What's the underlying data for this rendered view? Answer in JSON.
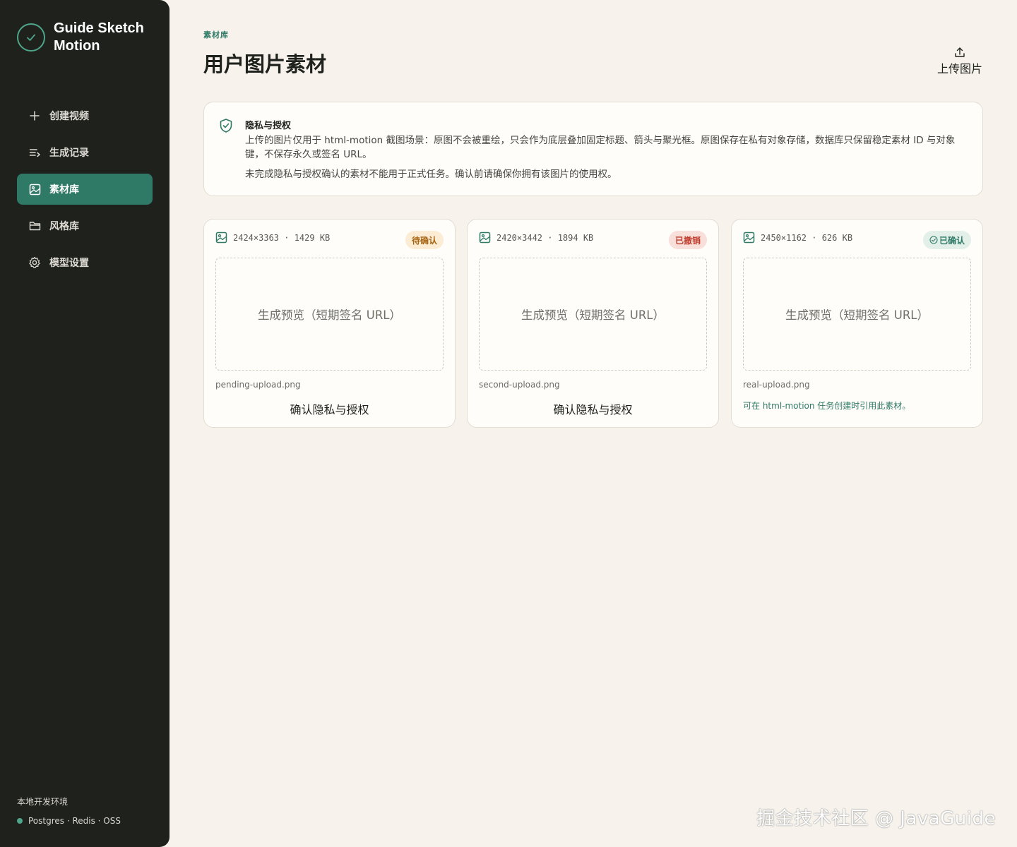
{
  "app": {
    "name": "Guide Sketch Motion"
  },
  "sidebar": {
    "items": [
      {
        "label": "创建视频",
        "icon": "plus-icon",
        "active": false
      },
      {
        "label": "生成记录",
        "icon": "list-icon",
        "active": false
      },
      {
        "label": "素材库",
        "icon": "image-icon",
        "active": true
      },
      {
        "label": "风格库",
        "icon": "folder-icon",
        "active": false
      },
      {
        "label": "模型设置",
        "icon": "gear-icon",
        "active": false
      }
    ],
    "env_label": "本地开发环境",
    "env_status": "Postgres · Redis · OSS"
  },
  "header": {
    "eyebrow": "素材库",
    "title": "用户图片素材",
    "upload_label": "上传图片"
  },
  "notice": {
    "title": "隐私与授权",
    "body": "上传的图片仅用于 html-motion 截图场景：原图不会被重绘，只会作为底层叠加固定标题、箭头与聚光框。原图保存在私有对象存储，数据库只保留稳定素材 ID 与对象键，不保存永久或签名 URL。",
    "body2": "未完成隐私与授权确认的素材不能用于正式任务。确认前请确保你拥有该图片的使用权。"
  },
  "cards": [
    {
      "meta": "2424×3363 · 1429 KB",
      "status": "待确认",
      "status_color": "#a86412",
      "preview_text": "生成预览（短期签名 URL）",
      "filename": "pending-upload.png",
      "action": "确认隐私与授权"
    },
    {
      "meta": "2420×3442 · 1894 KB",
      "status": "已撤销",
      "status_color": "#bf3a2a",
      "preview_text": "生成预览（短期签名 URL）",
      "filename": "second-upload.png",
      "action": "确认隐私与授权"
    },
    {
      "meta": "2450×1162 · 626 KB",
      "status": "已确认",
      "status_color": "#2f7a66",
      "preview_text": "生成预览（短期签名 URL）",
      "filename": "real-upload.png",
      "note": "可在 html-motion 任务创建时引用此素材。"
    }
  ],
  "watermark": "掘金技术社区 @ JavaGuide",
  "colors": {
    "sidebar_bg": "#1f211d",
    "accent": "#2f7a66",
    "page_bg": "#f7f3ec"
  }
}
